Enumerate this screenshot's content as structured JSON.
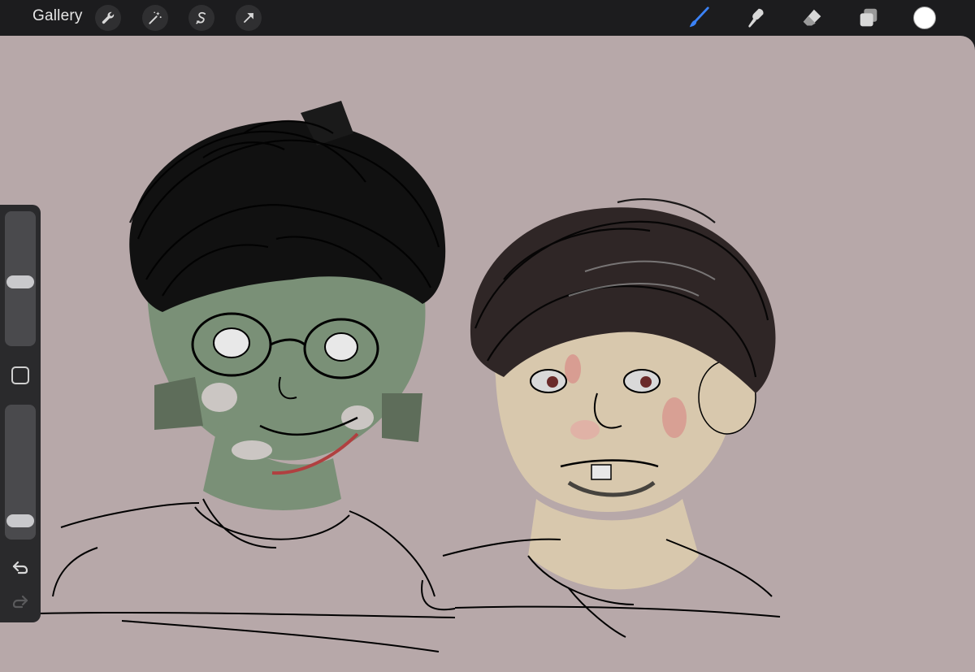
{
  "topbar": {
    "gallery_label": "Gallery",
    "left_tools": [
      {
        "name": "actions-wrench-icon"
      },
      {
        "name": "adjustments-magic-wand-icon"
      },
      {
        "name": "selection-icon"
      },
      {
        "name": "transform-arrow-icon"
      }
    ],
    "right_tools": [
      {
        "name": "brush-icon",
        "active": true
      },
      {
        "name": "smudge-icon",
        "active": false
      },
      {
        "name": "eraser-icon",
        "active": false
      },
      {
        "name": "layers-icon",
        "active": false
      }
    ],
    "current_color": "#ffffff"
  },
  "sidebar": {
    "brush_size_level": 0.47,
    "opacity_level": 0.09
  },
  "canvas": {
    "background": "#b7a8a9"
  },
  "colors": {
    "accent_active": "#3b82f6",
    "toolbar_bg": "#1c1c1e",
    "icon": "#d8d8d8"
  }
}
